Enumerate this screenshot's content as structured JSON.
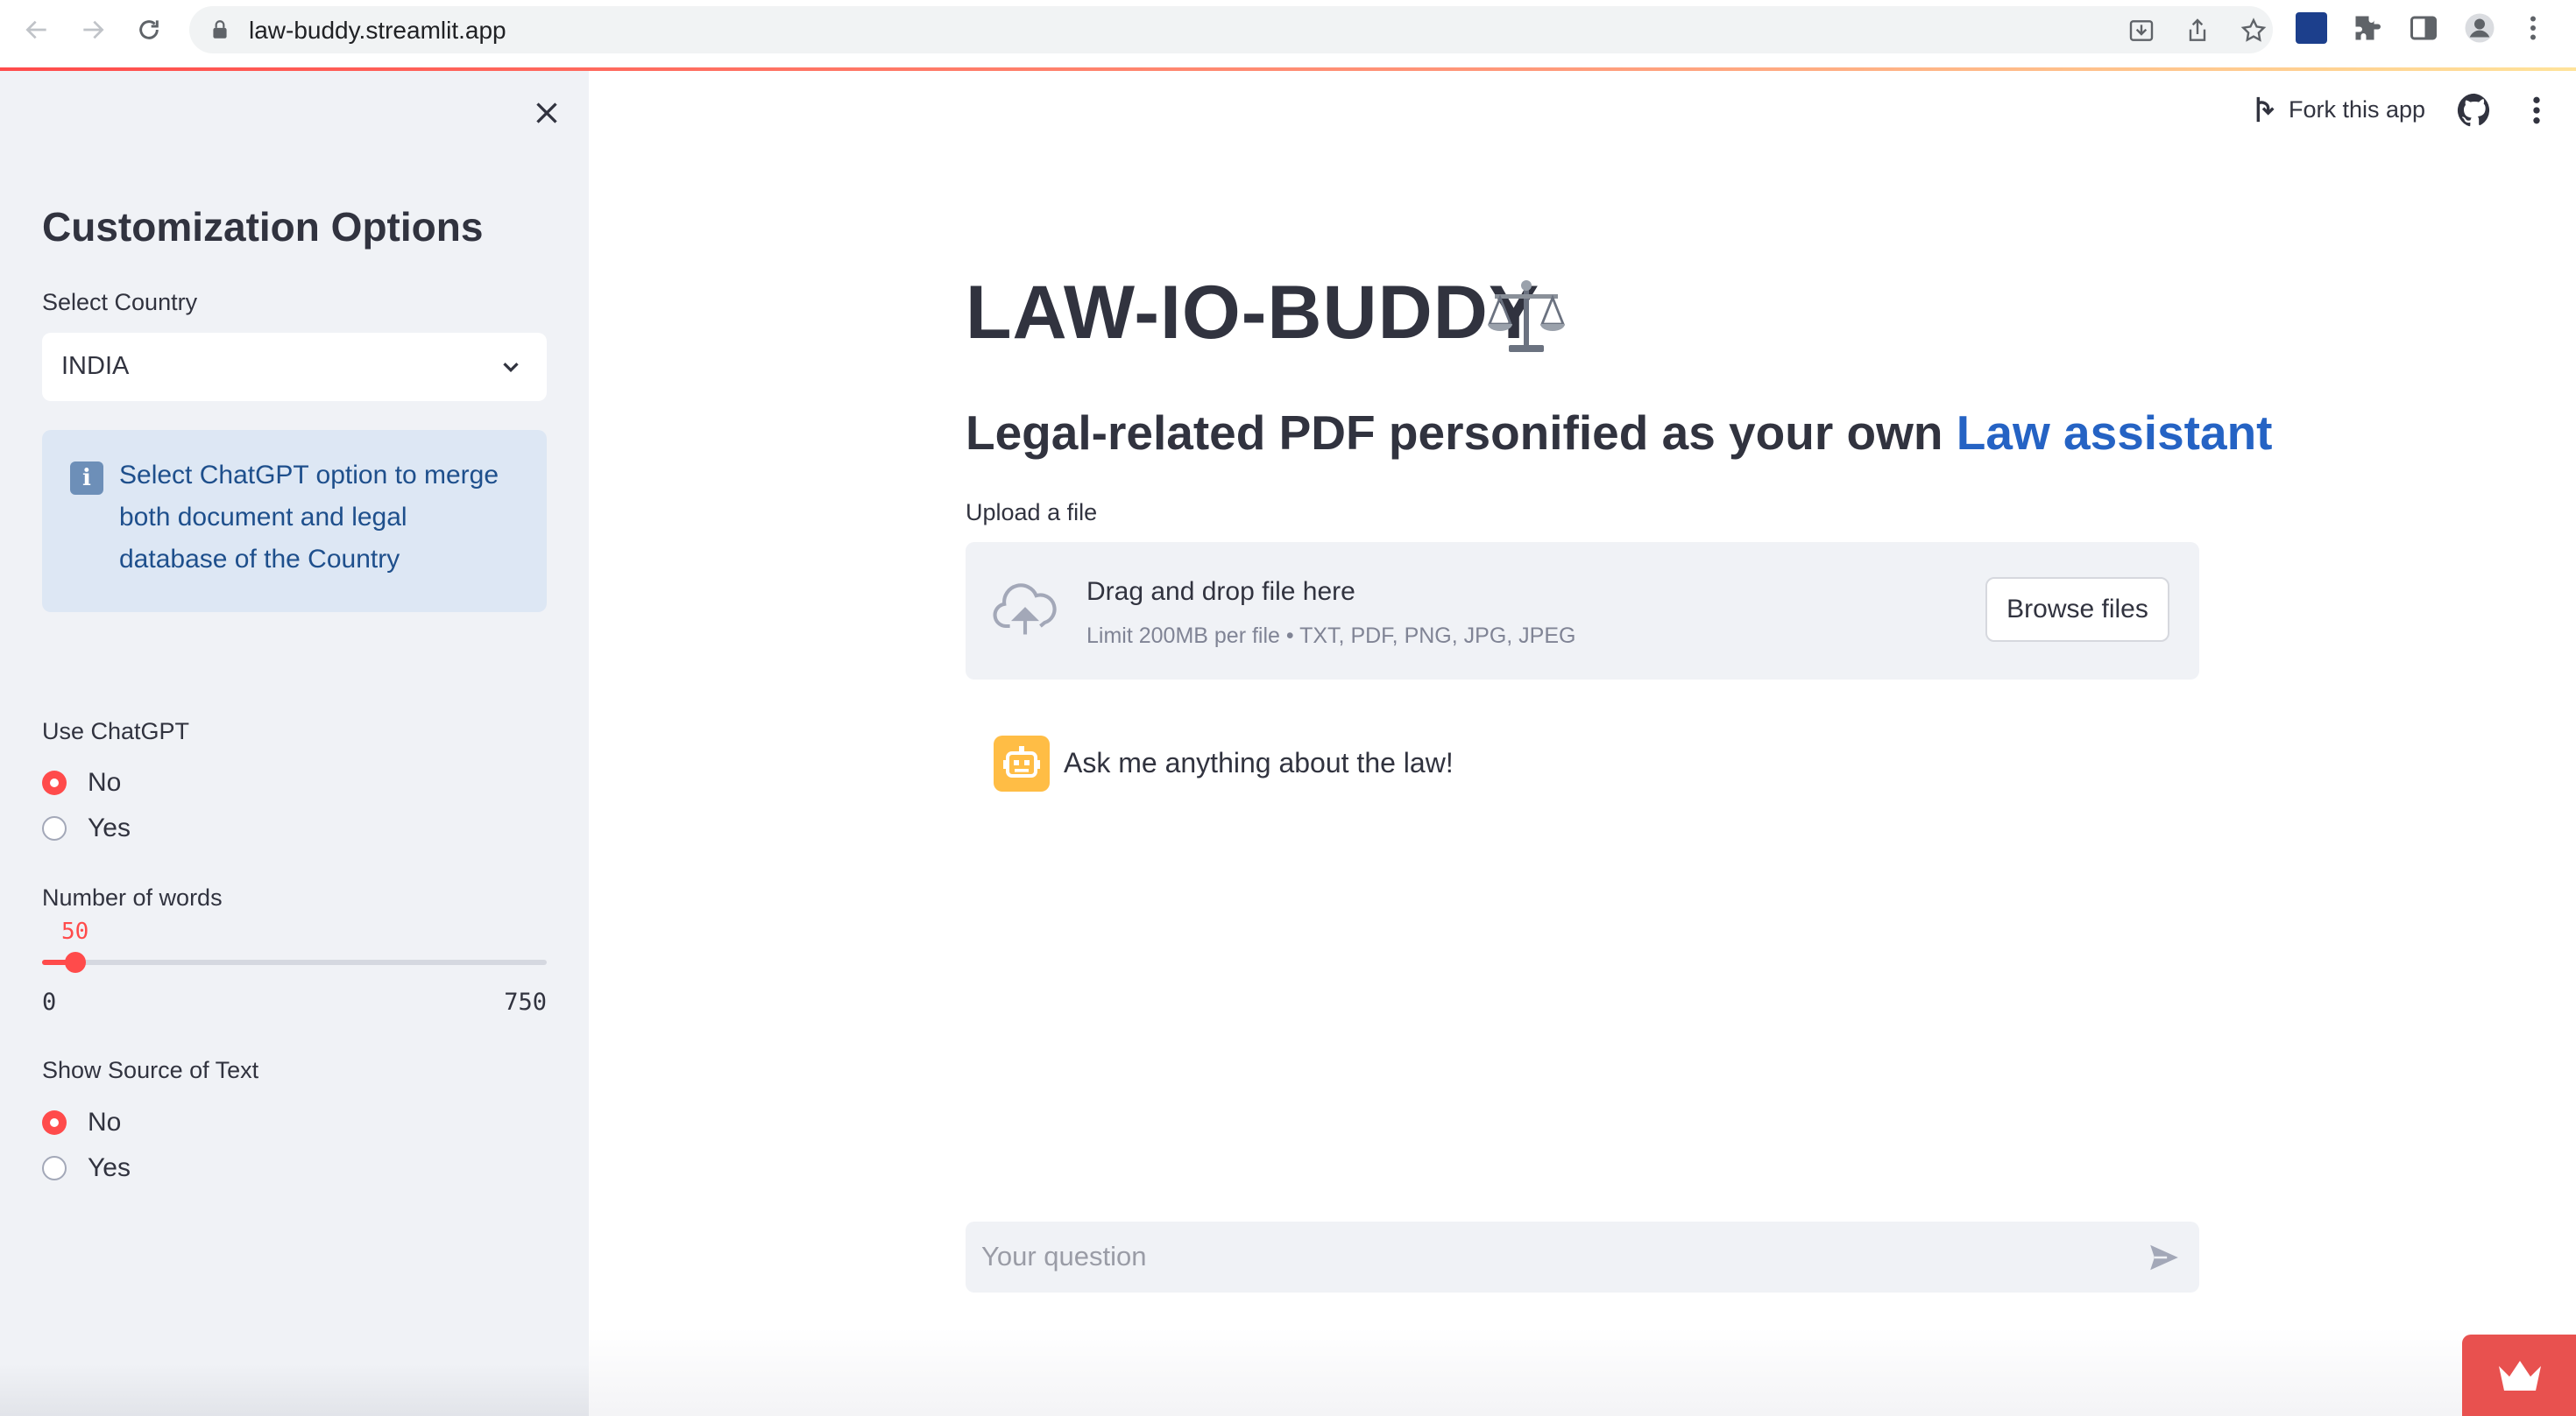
{
  "browser": {
    "url": "law-buddy.streamlit.app"
  },
  "sidebar": {
    "title": "Customization Options",
    "country": {
      "label": "Select Country",
      "value": "INDIA"
    },
    "info": "Select ChatGPT option to merge both document and legal database of the Country",
    "use_chatgpt": {
      "label": "Use ChatGPT",
      "options": [
        "No",
        "Yes"
      ],
      "selected": "No"
    },
    "words": {
      "label": "Number of words",
      "value": "50",
      "min": "0",
      "max": "750",
      "fraction": 0.0667
    },
    "show_source": {
      "label": "Show Source of Text",
      "options": [
        "No",
        "Yes"
      ],
      "selected": "No"
    }
  },
  "header": {
    "fork_label": "Fork this app"
  },
  "main": {
    "title": "LAW-IO-BUDDY",
    "subtitle_prefix": "Legal-related PDF personified as your own ",
    "subtitle_accent": "Law assistant",
    "upload": {
      "label": "Upload a file",
      "title": "Drag and drop file here",
      "limits": "Limit 200MB per file • TXT, PDF, PNG, JPG, JPEG",
      "button": "Browse files"
    },
    "chat": {
      "message": "Ask me anything about the law!",
      "placeholder": "Your question"
    }
  },
  "colors": {
    "accent": "#ff4b4b",
    "link_blue": "#2563c4",
    "sidebar_bg": "#f0f2f6",
    "info_bg": "#dde7f4",
    "avatar_bg": "#ffbd45"
  },
  "icons": [
    "back-icon",
    "forward-icon",
    "reload-icon",
    "lock-icon",
    "download-icon",
    "share-icon",
    "star-icon",
    "extension-icon",
    "puzzle-icon",
    "sidepanel-icon",
    "profile-icon",
    "menu-icon",
    "close-icon",
    "chevron-down-icon",
    "info-icon",
    "fork-icon",
    "github-icon",
    "more-icon",
    "scales-icon",
    "cloud-upload-icon",
    "robot-icon",
    "send-icon",
    "crown-icon"
  ]
}
